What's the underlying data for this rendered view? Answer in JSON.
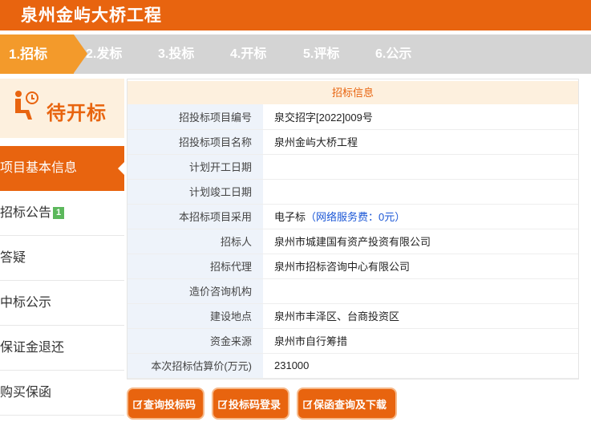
{
  "header": {
    "title": "泉州金屿大桥工程"
  },
  "steps": [
    "1.招标",
    "2.发标",
    "3.投标",
    "4.开标",
    "5.评标",
    "6.公示"
  ],
  "status": {
    "text": "待开标",
    "icon": "person-clock-icon"
  },
  "sidebar": {
    "items": [
      {
        "label": "项目基本信息"
      },
      {
        "label": "招标公告",
        "badge": "1"
      },
      {
        "label": "答疑"
      },
      {
        "label": "中标公示"
      },
      {
        "label": "保证金退还"
      },
      {
        "label": "购买保函"
      }
    ]
  },
  "info": {
    "title": "招标信息",
    "rows": [
      {
        "label": "招投标项目编号",
        "value": "泉交招字[2022]009号"
      },
      {
        "label": "招投标项目名称",
        "value": "泉州金屿大桥工程"
      },
      {
        "label": "计划开工日期",
        "value": ""
      },
      {
        "label": "计划竣工日期",
        "value": ""
      },
      {
        "label": "本招标项目采用",
        "value": "电子标",
        "value_extra": "（网络服务费：0元）"
      },
      {
        "label": "招标人",
        "value": "泉州市城建国有资产投资有限公司"
      },
      {
        "label": "招标代理",
        "value": "泉州市招标咨询中心有限公司"
      },
      {
        "label": "造价咨询机构",
        "value": ""
      },
      {
        "label": "建设地点",
        "value": "泉州市丰泽区、台商投资区"
      },
      {
        "label": "资金来源",
        "value": "泉州市自行筹措"
      },
      {
        "label": "本次招标估算价(万元)",
        "value": "231000"
      }
    ]
  },
  "actions": {
    "query_code": "查询投标码",
    "code_login": "投标码登录",
    "guarantee_download": "保函查询及下载"
  },
  "colors": {
    "primary": "#e8640f",
    "step_active": "#f39a2b",
    "steps_bg": "#d4d4d4",
    "label_bg": "#eef3fa",
    "badge": "#5cb85c",
    "link": "#1a56d6"
  }
}
